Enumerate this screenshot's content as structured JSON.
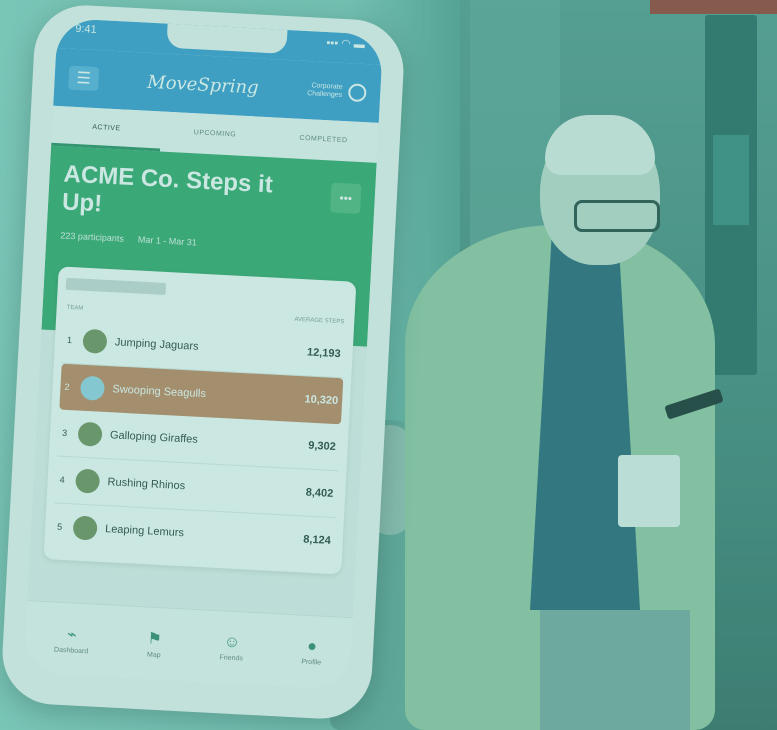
{
  "status": {
    "time": "9:41",
    "signal": "▪▪▪ ◠ ▬"
  },
  "header": {
    "logo": "MoveSpring",
    "org_line1": "Corporate",
    "org_line2": "Challenges",
    "menu_icon": "hamburger-icon",
    "profile_icon": "circle-icon"
  },
  "tabs": [
    {
      "label": "ACTIVE"
    },
    {
      "label": "UPCOMING"
    },
    {
      "label": "COMPLETED"
    }
  ],
  "challenge": {
    "title": "ACME Co. Steps it Up!",
    "participants": "223 participants",
    "dates": "Mar 1 - Mar 31",
    "more_label": "•••"
  },
  "leaderboard": {
    "col_left": "TEAM",
    "col_right": "AVERAGE STEPS",
    "rows": [
      {
        "rank": "1",
        "name": "Jumping Jaguars",
        "value": "12,193"
      },
      {
        "rank": "2",
        "name": "Swooping Seagulls",
        "value": "10,320"
      },
      {
        "rank": "3",
        "name": "Galloping Giraffes",
        "value": "9,302"
      },
      {
        "rank": "4",
        "name": "Rushing Rhinos",
        "value": "8,402"
      },
      {
        "rank": "5",
        "name": "Leaping Lemurs",
        "value": "8,124"
      }
    ]
  },
  "bottom_nav": [
    {
      "label": "Dashboard",
      "icon": "activity-icon"
    },
    {
      "label": "Map",
      "icon": "map-icon"
    },
    {
      "label": "Friends",
      "icon": "friends-icon"
    },
    {
      "label": "Profile",
      "icon": "profile-icon"
    }
  ],
  "colors": {
    "tint": "#40aa96",
    "header_blue": "#3d9bd4",
    "banner_green": "#3aa86b",
    "highlight": "#c9865f"
  }
}
